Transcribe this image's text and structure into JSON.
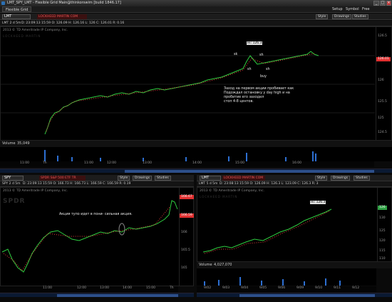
{
  "window": {
    "title": "LMT_SPY_LMT - Flexible Grid Main@thinkorswim [build 1846.17]",
    "tab": "Flexible Grid",
    "menu": [
      "Setup",
      "Symbol",
      "Free"
    ]
  },
  "panel_main": {
    "symbol": "LMT",
    "description": "LOCKHEED MARTIN COM",
    "aggregation": "LMT 2 d 5m",
    "buttons": {
      "style": "Style",
      "drawings": "Drawings",
      "studies": "Studies"
    },
    "quote": "D: 23:09:13 15:59  O: 126.09  H: 126.16  L: 126  C: 126.01  R: 0.16",
    "copyright": "2013 © TD Ameritrade IP Company, Inc.",
    "watermark": "LOCKHEED MARTIN",
    "price_tag": "126.01",
    "hi_label": "Hi: 126.3",
    "volume_label": "Volume",
    "volume_value": "35,049",
    "annotations": {
      "note": "Заход на первом    акции пробивает как\nПодождал остановку у day high и на\nпробитие его заходил\nстоп 4-8 центов.",
      "sk": "sk",
      "sh1": "sh",
      "sh2": "sh",
      "buy": "buy",
      "sh3": "sh"
    },
    "y_ticks": [
      "126.5",
      "126",
      "125.5",
      "125",
      "124.5"
    ],
    "x_ticks": [
      "11:00",
      "12:00",
      "13:00",
      "14:00",
      "15:00",
      "16:00",
      "17:00",
      "Th",
      "11:00",
      "12:00",
      "13:00",
      "14:00",
      "15:00",
      "16:00"
    ]
  },
  "panel_spy": {
    "symbol": "SPY",
    "description": "SPDR S&P 500 ETF TR",
    "aggregation": "SPY 2 d 5m",
    "quote": "D: 23:09:13 15:59  O: 166.73  H: 166.73  L: 166.59  C: 166.59  R: 0.19",
    "buttons": {
      "style": "Style",
      "drawings": "Drawings",
      "studies": "Studies"
    },
    "copyright": "2013 © TD Ameritrade IP Company, Inc.",
    "watermark": "SPDR",
    "price_tag": "166.59",
    "price_tag_top": "166.67",
    "annotation": "Акция тупо идет в пони- сильная акция.",
    "x_ticks": [
      "11:00",
      "12:00",
      "13:00",
      "14:00",
      "15:00",
      "Th"
    ],
    "y_ticks": [
      "166",
      "165.5",
      "165"
    ]
  },
  "panel_lmt2": {
    "symbol": "LMT",
    "description": "LOCKHEED MARTIN COM",
    "aggregation": "LMT 5 d 5m",
    "quote": "D: 23:08:13 15:59  O: 126.09  H: 126.3  L: 123.09  C: 126.3  R: 3",
    "buttons": {
      "style": "Style",
      "drawings": "Drawings",
      "studies": "Studies"
    },
    "copyright": "2013 © TD Ameritrade IP Company, Inc.",
    "watermark": "LOCKHEED MARTIN",
    "price_tag": "126",
    "hi_label": "Hi: 126.3",
    "volume_label": "Volume",
    "volume_value": "4,027,070",
    "x_ticks": [
      "9/02",
      "9/03",
      "9/04",
      "9/05",
      "9/06",
      "9/09",
      "9/10",
      "9/11",
      "9/12"
    ],
    "y_ticks": [
      "130",
      "125",
      "120",
      "115",
      "110"
    ]
  },
  "colors": {
    "up": "#2ecc40",
    "down": "#e23a3a",
    "accent": "#2d6fd2"
  }
}
